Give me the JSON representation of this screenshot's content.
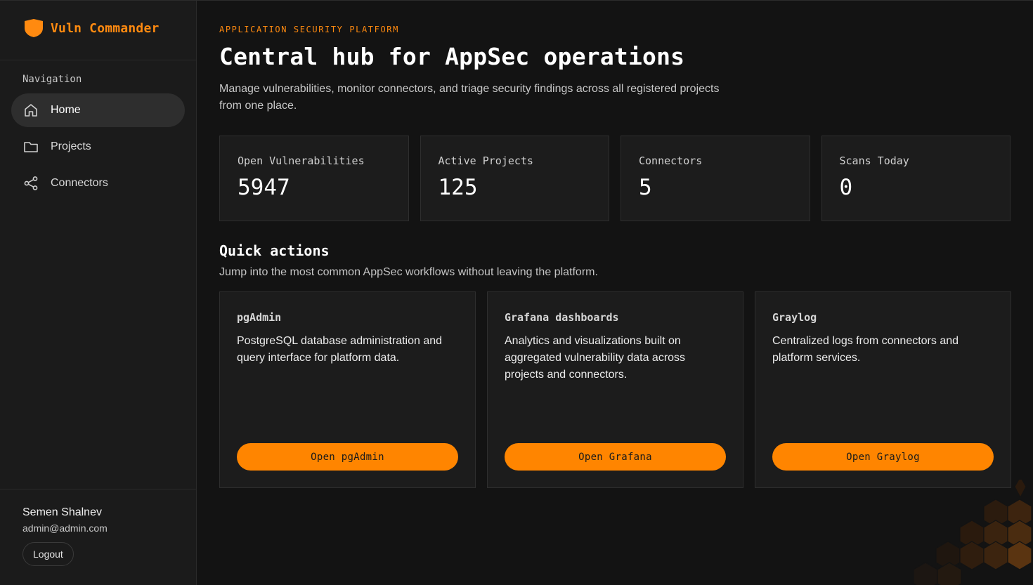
{
  "app": {
    "name": "Vuln Commander",
    "accent": "#ff8a10"
  },
  "sidebar": {
    "nav_heading": "Navigation",
    "items": [
      {
        "label": "Home",
        "icon": "home-icon",
        "active": true
      },
      {
        "label": "Projects",
        "icon": "folder-icon",
        "active": false
      },
      {
        "label": "Connectors",
        "icon": "share-nodes-icon",
        "active": false
      }
    ],
    "user": {
      "name": "Semen Shalnev",
      "email": "admin@admin.com",
      "logout_label": "Logout"
    }
  },
  "hero": {
    "eyebrow": "APPLICATION SECURITY PLATFORM",
    "title": "Central hub for AppSec operations",
    "description": "Manage vulnerabilities, monitor connectors, and triage security findings across all registered projects from one place."
  },
  "stats": [
    {
      "label": "Open Vulnerabilities",
      "value": "5947"
    },
    {
      "label": "Active Projects",
      "value": "125"
    },
    {
      "label": "Connectors",
      "value": "5"
    },
    {
      "label": "Scans Today",
      "value": "0"
    }
  ],
  "quick_actions": {
    "title": "Quick actions",
    "description": "Jump into the most common AppSec workflows without leaving the platform.",
    "cards": [
      {
        "title": "pgAdmin",
        "description": "PostgreSQL database administration and query interface for platform data.",
        "button": "Open pgAdmin"
      },
      {
        "title": "Grafana dashboards",
        "description": "Analytics and visualizations built on aggregated vulnerability data across projects and connectors.",
        "button": "Open Grafana"
      },
      {
        "title": "Graylog",
        "description": "Centralized logs from connectors and platform services.",
        "button": "Open Graylog"
      }
    ]
  },
  "colors": {
    "background": "#131313",
    "sidebar": "#1b1b1b",
    "card": "#1c1c1c",
    "button": "#ff8500"
  }
}
